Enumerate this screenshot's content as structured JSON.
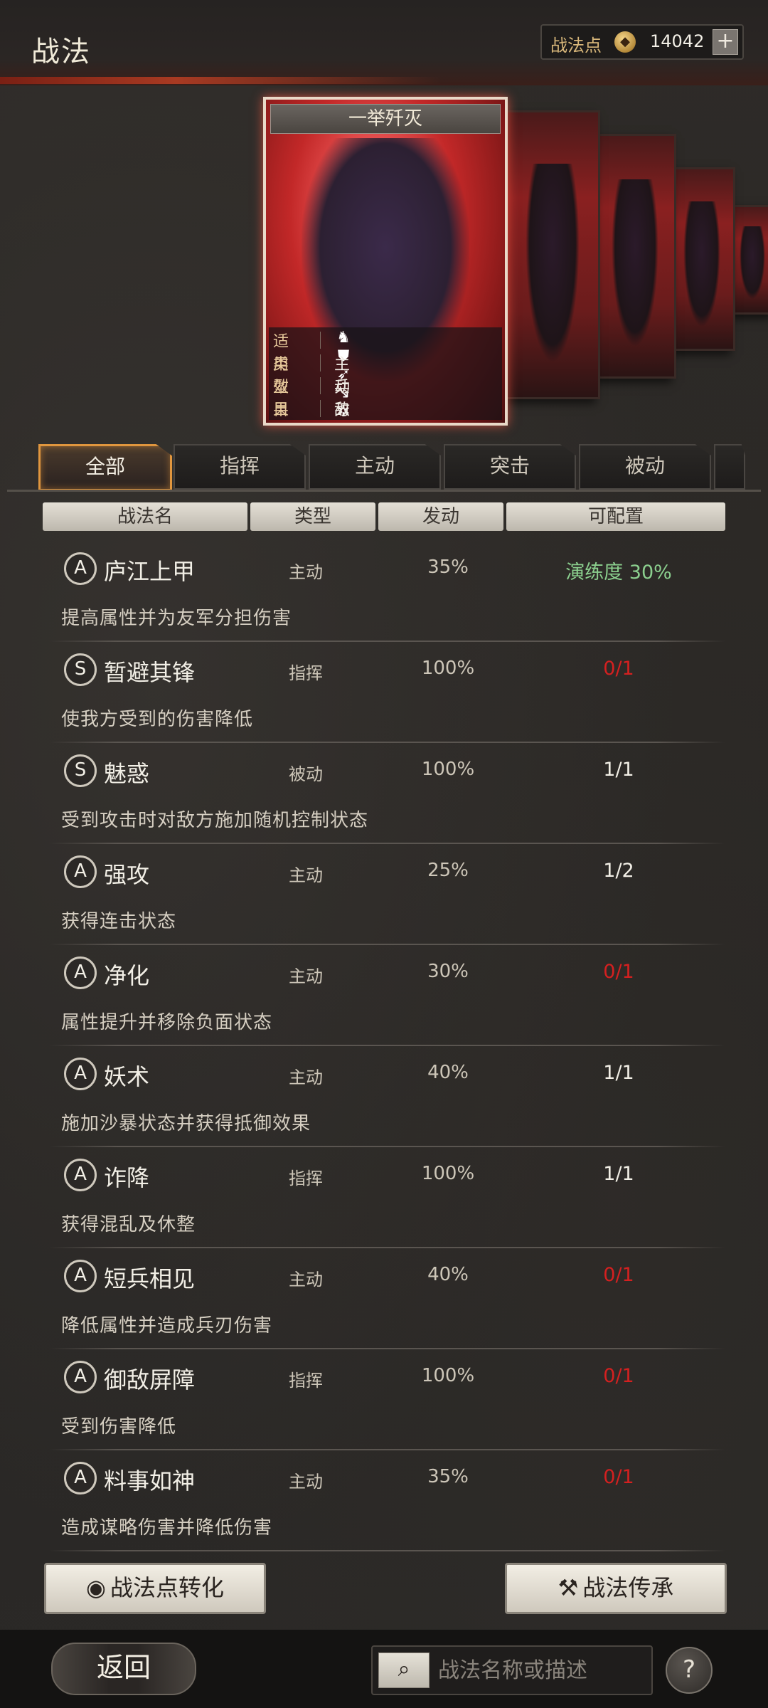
{
  "header": {
    "title": "战法",
    "points_label": "战法点",
    "points_icon": "coin-icon",
    "points_value": "14042",
    "add_symbol": "+"
  },
  "featured_card": {
    "name": "一举歼灭",
    "rows": [
      {
        "key": "适用",
        "value": ""
      },
      {
        "key": "类型",
        "value": "主动"
      },
      {
        "key": "效果",
        "value": "兵刃单体"
      },
      {
        "key": "目标",
        "value": "敌军单体"
      }
    ],
    "applicable_icons": [
      "cavalry-icon",
      "shield-icon",
      "bow-icon",
      "spear-icon",
      "wheel-icon"
    ]
  },
  "tabs": [
    {
      "label": "全部",
      "active": true
    },
    {
      "label": "指挥",
      "active": false
    },
    {
      "label": "主动",
      "active": false
    },
    {
      "label": "突击",
      "active": false
    },
    {
      "label": "被动",
      "active": false
    }
  ],
  "columns": [
    "战法名",
    "类型",
    "发动",
    "可配置"
  ],
  "tactics": [
    {
      "grade": "A",
      "name": "庐江上甲",
      "type": "主动",
      "rate": "35%",
      "config": "演练度 30%",
      "config_status": "training",
      "desc": "提高属性并为友军分担伤害"
    },
    {
      "grade": "S",
      "name": "暂避其锋",
      "type": "指挥",
      "rate": "100%",
      "config": "0/1",
      "config_status": "unavailable",
      "desc": "使我方受到的伤害降低"
    },
    {
      "grade": "S",
      "name": "魅惑",
      "type": "被动",
      "rate": "100%",
      "config": "1/1",
      "config_status": "available",
      "desc": "受到攻击时对敌方施加随机控制状态"
    },
    {
      "grade": "A",
      "name": "强攻",
      "type": "主动",
      "rate": "25%",
      "config": "1/2",
      "config_status": "available",
      "desc": "获得连击状态"
    },
    {
      "grade": "A",
      "name": "净化",
      "type": "主动",
      "rate": "30%",
      "config": "0/1",
      "config_status": "unavailable",
      "desc": "属性提升并移除负面状态"
    },
    {
      "grade": "A",
      "name": "妖术",
      "type": "主动",
      "rate": "40%",
      "config": "1/1",
      "config_status": "available",
      "desc": "施加沙暴状态并获得抵御效果"
    },
    {
      "grade": "A",
      "name": "诈降",
      "type": "指挥",
      "rate": "100%",
      "config": "1/1",
      "config_status": "available",
      "desc": "获得混乱及休整"
    },
    {
      "grade": "A",
      "name": "短兵相见",
      "type": "主动",
      "rate": "40%",
      "config": "0/1",
      "config_status": "unavailable",
      "desc": "降低属性并造成兵刃伤害"
    },
    {
      "grade": "A",
      "name": "御敌屏障",
      "type": "指挥",
      "rate": "100%",
      "config": "0/1",
      "config_status": "unavailable",
      "desc": "受到伤害降低"
    },
    {
      "grade": "A",
      "name": "料事如神",
      "type": "主动",
      "rate": "35%",
      "config": "0/1",
      "config_status": "unavailable",
      "desc": "造成谋略伤害并降低伤害"
    }
  ],
  "buttons": {
    "convert": "战法点转化",
    "inherit": "战法传承"
  },
  "footer": {
    "back": "返回",
    "search_placeholder": "战法名称或描述",
    "help": "?"
  },
  "colors": {
    "accent_orange": "#e0963e",
    "unavailable_red": "#d42020",
    "training_green": "#8bcf8e"
  }
}
